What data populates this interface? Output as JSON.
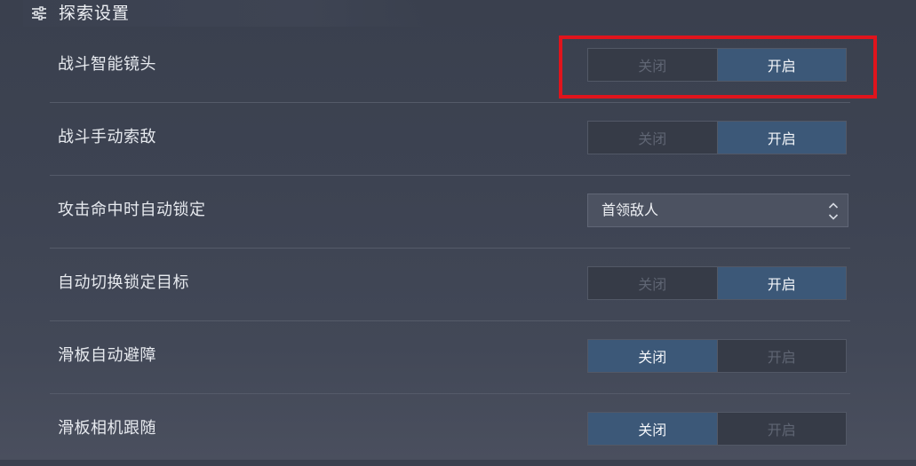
{
  "header": {
    "title": "探索设置",
    "icon": "sliders-icon"
  },
  "settings": [
    {
      "label": "战斗智能镜头",
      "type": "toggle",
      "options": [
        "关闭",
        "开启"
      ],
      "selected": "开启"
    },
    {
      "label": "战斗手动索敌",
      "type": "toggle",
      "options": [
        "关闭",
        "开启"
      ],
      "selected": "开启"
    },
    {
      "label": "攻击命中时自动锁定",
      "type": "select",
      "value": "首领敌人",
      "icon": "up-down-arrows-icon"
    },
    {
      "label": "自动切换锁定目标",
      "type": "toggle",
      "options": [
        "关闭",
        "开启"
      ],
      "selected": "开启"
    },
    {
      "label": "滑板自动避障",
      "type": "toggle",
      "options": [
        "关闭",
        "开启"
      ],
      "selected": "关闭"
    },
    {
      "label": "滑板相机跟随",
      "type": "toggle",
      "options": [
        "关闭",
        "开启"
      ],
      "selected": "关闭"
    }
  ],
  "colors": {
    "background": "#3d4352",
    "active_option": "#3c5878",
    "inactive_option": "#363b47",
    "highlight_box": "#e0141c"
  }
}
